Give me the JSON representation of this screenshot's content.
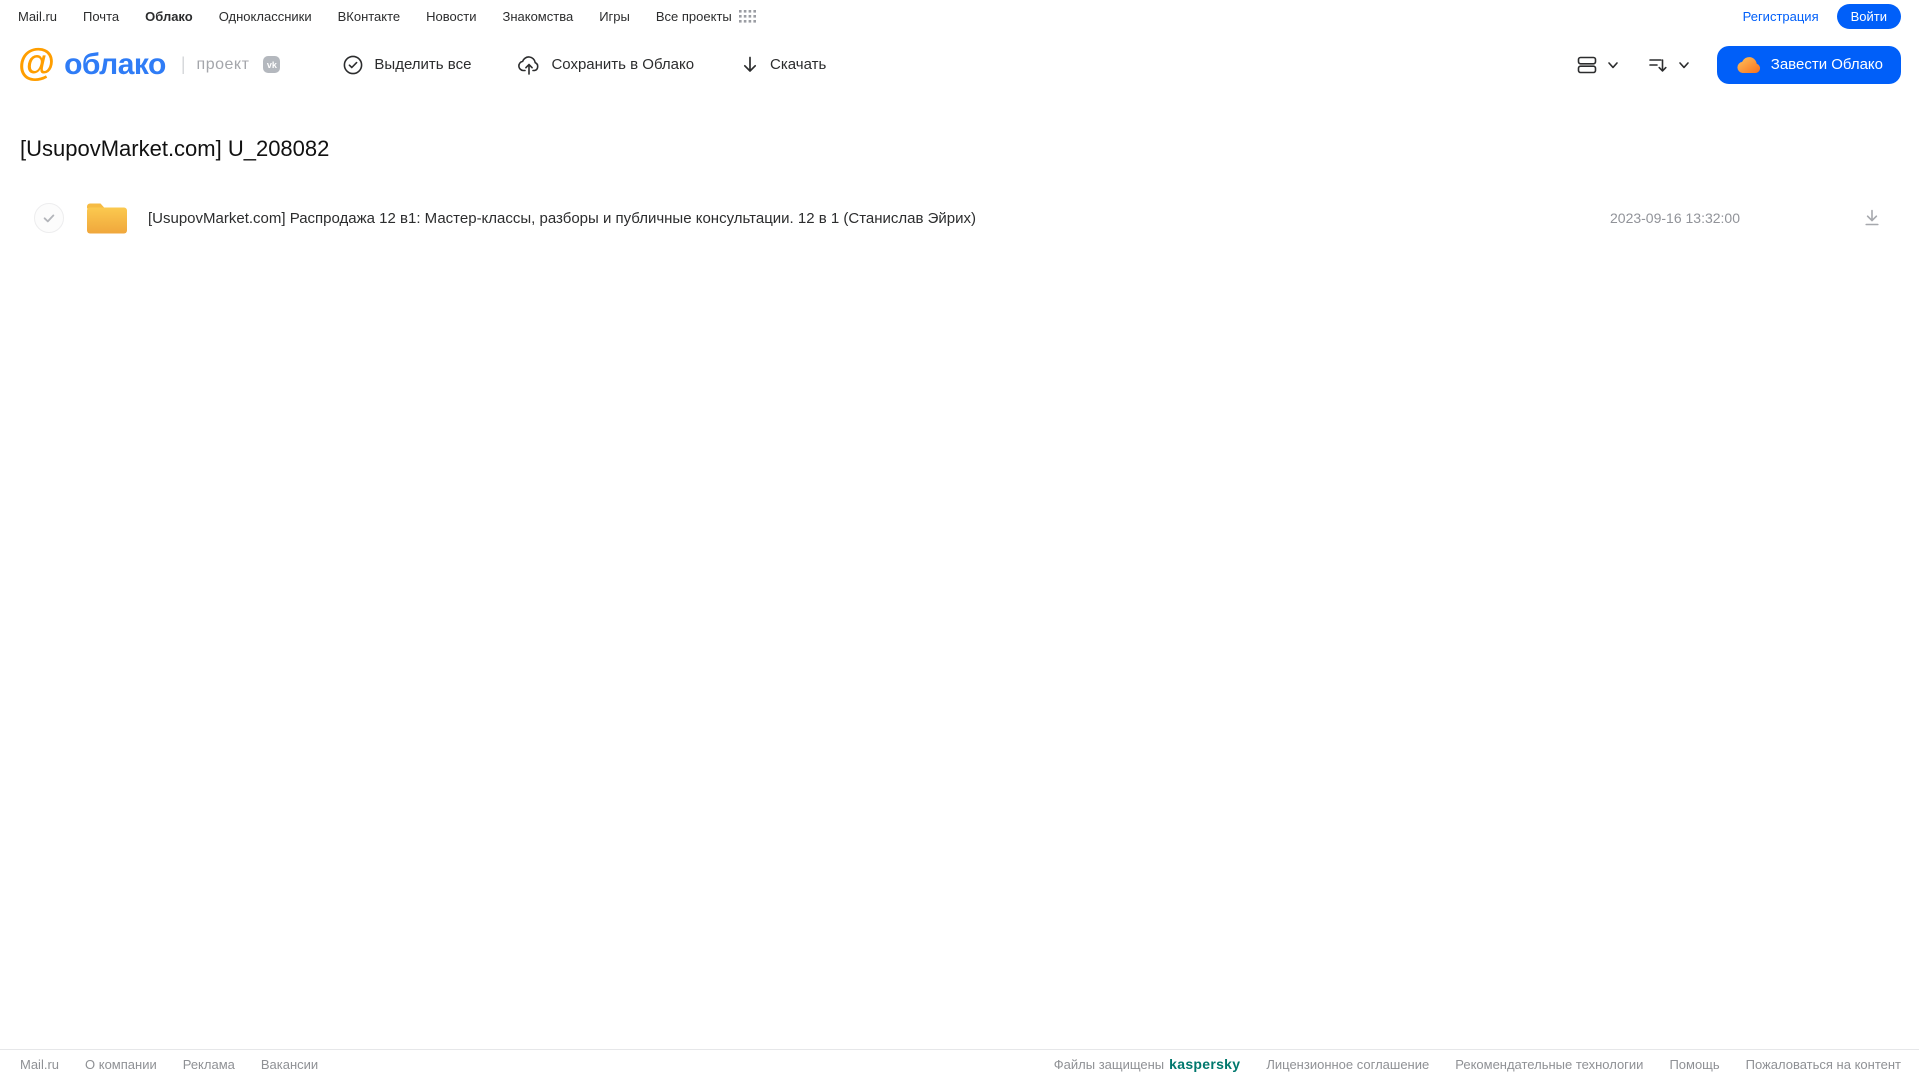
{
  "topnav": {
    "items": [
      {
        "label": "Mail.ru"
      },
      {
        "label": "Почта"
      },
      {
        "label": "Облако"
      },
      {
        "label": "Одноклассники"
      },
      {
        "label": "ВКонтакте"
      },
      {
        "label": "Новости"
      },
      {
        "label": "Знакомства"
      },
      {
        "label": "Игры"
      },
      {
        "label": "Все проекты"
      }
    ],
    "registration_label": "Регистрация",
    "login_label": "Войти"
  },
  "header": {
    "logo_at": "@",
    "logo_text": "облако",
    "logo_project": "проект",
    "vk_badge": "vk",
    "toolbar": {
      "select_all_label": "Выделить все",
      "save_to_cloud_label": "Сохранить в Облако",
      "download_label": "Скачать"
    },
    "get_cloud_label": "Завести Облако"
  },
  "main": {
    "title": "[UsupovMarket.com] U_208082",
    "files": [
      {
        "name": "[UsupovMarket.com] Распродажа 12 в1: Мастер-классы, разборы и публичные консультации. 12 в 1 (Станислав Эйрих)",
        "date": "2023-09-16 13:32:00"
      }
    ]
  },
  "footer": {
    "left": [
      "Mail.ru",
      "О компании",
      "Реклама",
      "Вакансии"
    ],
    "protected_label": "Файлы защищены",
    "kaspersky_label": "kaspersky",
    "right": [
      "Лицензионное соглашение",
      "Рекомендательные технологии",
      "Помощь",
      "Пожаловаться на контент"
    ]
  },
  "colors": {
    "accent_blue": "#005ff9",
    "logo_blue": "#2f7cf6",
    "logo_orange": "#ff9e00",
    "folder_yellow_top": "#fbc94f",
    "folder_yellow_bottom": "#f0a73c",
    "kaspersky_teal": "#00786d",
    "muted_gray": "#919399"
  }
}
